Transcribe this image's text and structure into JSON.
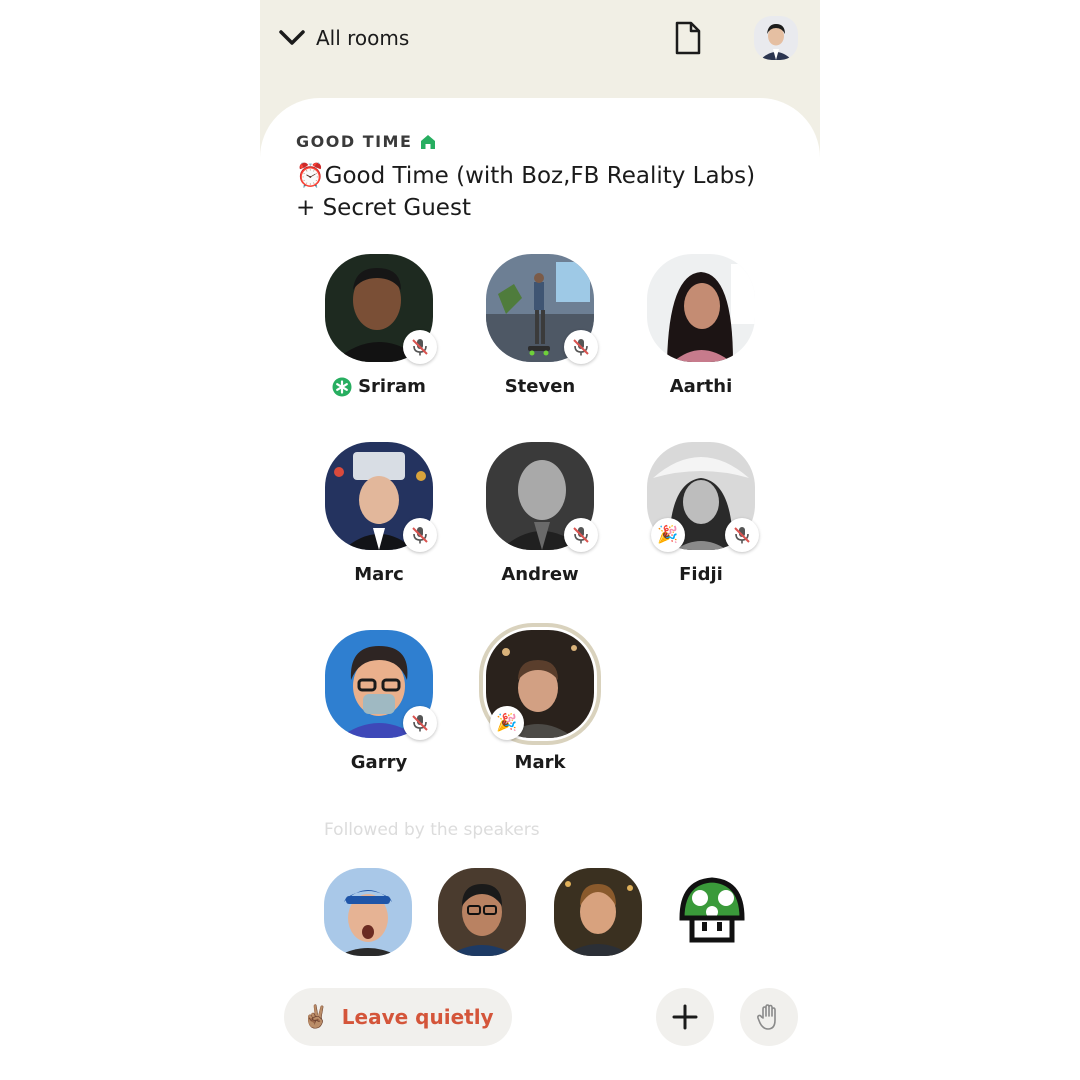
{
  "header": {
    "back_label": "All rooms"
  },
  "room": {
    "club_name": "GOOD TIME",
    "title": "⏰Good Time (with Boz,FB Reality Labs) + Secret Guest"
  },
  "speakers": [
    {
      "name": "Sriram",
      "moderator": true,
      "muted": true
    },
    {
      "name": "Steven",
      "muted": true
    },
    {
      "name": "Aarthi",
      "muted": false
    },
    {
      "name": "Marc",
      "muted": true
    },
    {
      "name": "Andrew",
      "muted": true
    },
    {
      "name": "Fidji",
      "muted": true,
      "new_user": true
    },
    {
      "name": "Garry",
      "muted": true
    },
    {
      "name": "Mark",
      "muted": false,
      "speaking": true,
      "new_user": true
    }
  ],
  "listeners": {
    "label": "Followed by the speakers",
    "count_visible": 4
  },
  "footer": {
    "leave_emoji": "✌🏽",
    "leave_label": "Leave quietly"
  },
  "colors": {
    "background": "#f1efe5",
    "sheet": "#ffffff",
    "leave_text": "#d4553a",
    "club_house_icon": "#27ae60",
    "button_bg": "#f1f0ed"
  },
  "icons": [
    "chevron-down-icon",
    "document-icon",
    "house-icon",
    "moderator-icon",
    "muted-mic-icon",
    "party-popper-icon",
    "plus-icon",
    "raise-hand-icon"
  ]
}
